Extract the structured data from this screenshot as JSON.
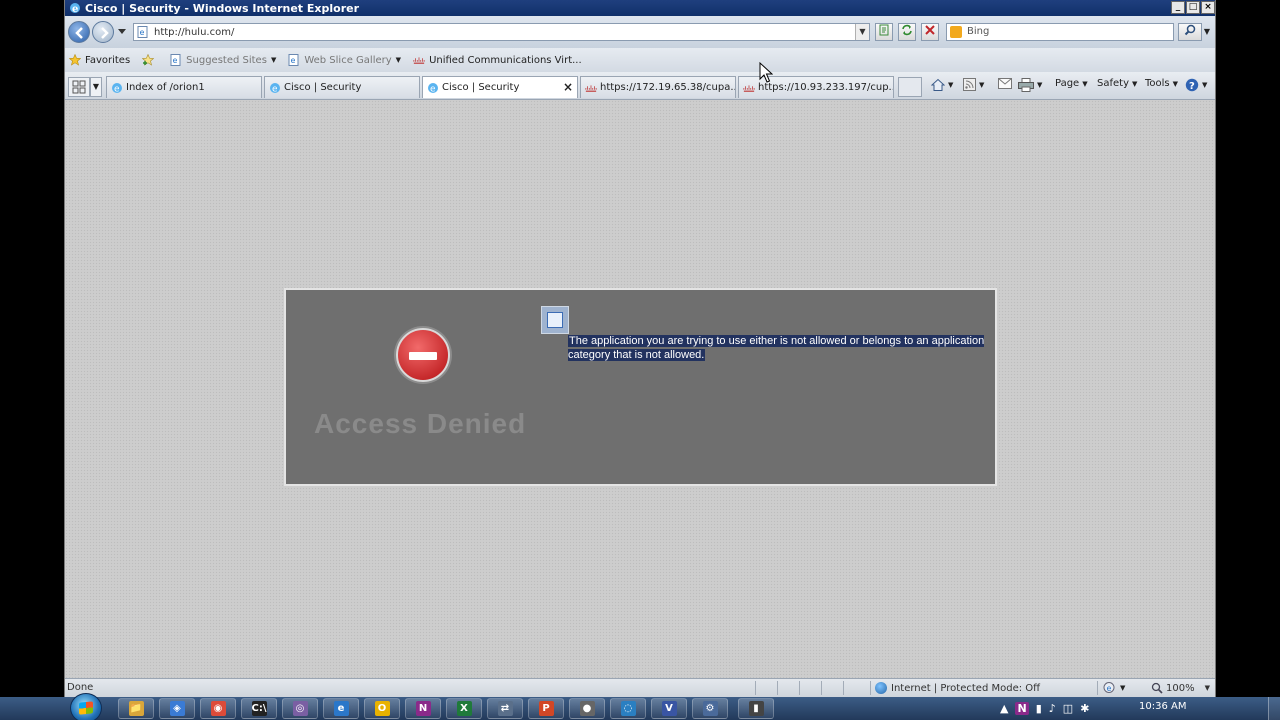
{
  "window": {
    "title": "Cisco | Security - Windows Internet Explorer",
    "controls": [
      "_",
      "□",
      "×"
    ]
  },
  "address_bar": {
    "url": "http://hulu.com/",
    "search_placeholder": "Bing"
  },
  "favorites_bar": {
    "favorites_label": "Favorites",
    "items": [
      {
        "label": "Suggested Sites",
        "icon": "ie-page-icon"
      },
      {
        "label": "Web Slice Gallery",
        "icon": "ie-page-icon"
      },
      {
        "label": "Unified Communications Virt...",
        "icon": "cisco-icon"
      }
    ]
  },
  "tabs": [
    {
      "label": "Index of /orion1",
      "icon": "ie-page-icon",
      "active": false
    },
    {
      "label": "Cisco | Security",
      "icon": "ie-page-icon",
      "active": false
    },
    {
      "label": "Cisco | Security",
      "icon": "ie-page-icon",
      "active": true
    },
    {
      "label": "https://172.19.65.38/cupa...",
      "icon": "cisco-icon",
      "active": false
    },
    {
      "label": "https://10.93.233.197/cup...",
      "icon": "cisco-icon",
      "active": false
    }
  ],
  "command_bar": {
    "page_label": "Page",
    "safety_label": "Safety",
    "tools_label": "Tools"
  },
  "content": {
    "message": "The application you are trying to use either is not allowed or belongs to an application category that is not allowed.",
    "heading": "Access Denied",
    "details": [
      "",
      "",
      "",
      ""
    ]
  },
  "status_bar": {
    "status": "Done",
    "zone": "Internet | Protected Mode: Off",
    "zoom": "100%"
  },
  "taskbar": {
    "apps": [
      {
        "name": "explorer",
        "glyph": "📁",
        "color": "#d9a63a"
      },
      {
        "name": "network",
        "glyph": "◈",
        "color": "#3a7bd5"
      },
      {
        "name": "chrome",
        "glyph": "◉",
        "color": "#dd4b39"
      },
      {
        "name": "cmd",
        "glyph": "C:\\",
        "color": "#222222"
      },
      {
        "name": "tool",
        "glyph": "◎",
        "color": "#7a5fa3"
      },
      {
        "name": "ie",
        "glyph": "e",
        "color": "#2b77c9"
      },
      {
        "name": "outlook",
        "glyph": "O",
        "color": "#e8b200"
      },
      {
        "name": "onenote",
        "glyph": "N",
        "color": "#8a2a8a"
      },
      {
        "name": "excel",
        "glyph": "X",
        "color": "#1f7a3a"
      },
      {
        "name": "remote",
        "glyph": "⇄",
        "color": "#5a6f8a"
      },
      {
        "name": "powerpoint",
        "glyph": "P",
        "color": "#d24726"
      },
      {
        "name": "media",
        "glyph": "●",
        "color": "#666666"
      },
      {
        "name": "jabber",
        "glyph": "◌",
        "color": "#2a7fc1"
      },
      {
        "name": "visio",
        "glyph": "V",
        "color": "#3955a3"
      },
      {
        "name": "settings",
        "glyph": "⚙",
        "color": "#4a6a9a"
      },
      {
        "name": "terminal",
        "glyph": "▮",
        "color": "#444444"
      }
    ],
    "clock": "10:36 AM"
  }
}
